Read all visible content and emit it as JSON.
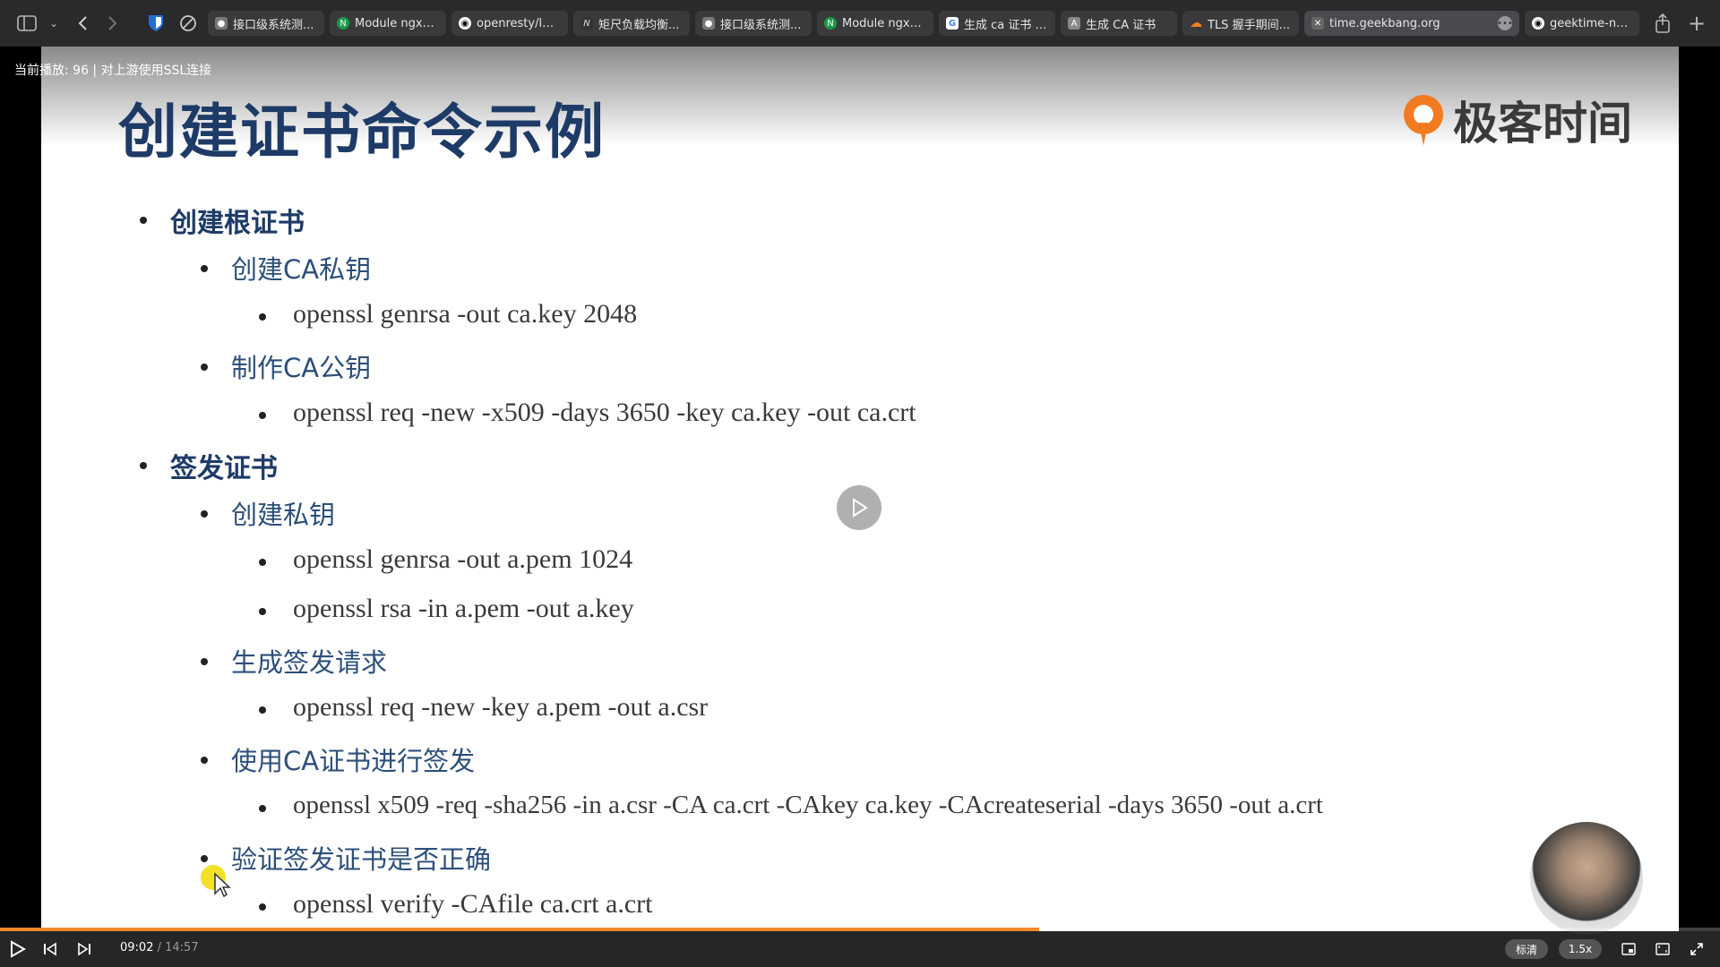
{
  "browser": {
    "tabs": [
      {
        "label": "接口级系统测...",
        "icon": "person-icon",
        "color": "#777777"
      },
      {
        "label": "Module ngx_h...",
        "icon": "nginx-icon",
        "color": "#1a9a44"
      },
      {
        "label": "openresty/lua...",
        "icon": "github-icon",
        "color": "#ffffff"
      },
      {
        "label": "矩尺负载均衡...",
        "icon": "n-icon",
        "color": "#dddddd"
      },
      {
        "label": "接口级系统测...",
        "icon": "person-icon",
        "color": "#777777"
      },
      {
        "label": "Module ngx_s...",
        "icon": "nginx-icon",
        "color": "#1a9a44"
      },
      {
        "label": "生成 ca 证书 -...",
        "icon": "google-icon",
        "color": "#4285f4"
      },
      {
        "label": "生成 CA 证书",
        "icon": "a-icon",
        "color": "#888888"
      },
      {
        "label": "TLS 握手期间...",
        "icon": "cloud-icon",
        "color": "#f48120"
      },
      {
        "label": "time.geekbang.org",
        "icon": "close-tab-icon",
        "color": "#666666",
        "active": true
      },
      {
        "label": "geektime-ngi...",
        "icon": "github-icon",
        "color": "#ffffff"
      }
    ]
  },
  "player": {
    "now_playing": "当前播放: 96 | 对上游使用SSL连接",
    "current_time": "09:02",
    "separator": " / ",
    "duration": "14:57",
    "progress": 0.604,
    "quality": "标清",
    "speed": "1.5x"
  },
  "slide": {
    "title": "创建证书命令示例",
    "logo_text": "极客时间",
    "lines": [
      {
        "level": 1,
        "text": "创建根证书"
      },
      {
        "level": 2,
        "text": "创建CA私钥"
      },
      {
        "level": 3,
        "text": "openssl genrsa -out ca.key 2048"
      },
      {
        "level": 2,
        "text": "制作CA公钥"
      },
      {
        "level": 3,
        "text": "openssl req -new -x509 -days 3650 -key ca.key -out ca.crt"
      },
      {
        "level": 1,
        "text": "签发证书"
      },
      {
        "level": 2,
        "text": "创建私钥"
      },
      {
        "level": 3,
        "text": "openssl genrsa -out a.pem 1024"
      },
      {
        "level": 3,
        "text": "openssl rsa -in a.pem -out a.key"
      },
      {
        "level": 2,
        "text": "生成签发请求"
      },
      {
        "level": 3,
        "text": "openssl req -new -key a.pem -out a.csr"
      },
      {
        "level": 2,
        "text": "使用CA证书进行签发"
      },
      {
        "level": 3,
        "text": "openssl x509 -req -sha256 -in a.csr -CA ca.crt -CAkey ca.key -CAcreateserial -days 3650 -out a.crt"
      },
      {
        "level": 2,
        "text": "验证签发证书是否正确"
      },
      {
        "level": 3,
        "text": "openssl verify -CAfile ca.crt a.crt"
      }
    ]
  }
}
